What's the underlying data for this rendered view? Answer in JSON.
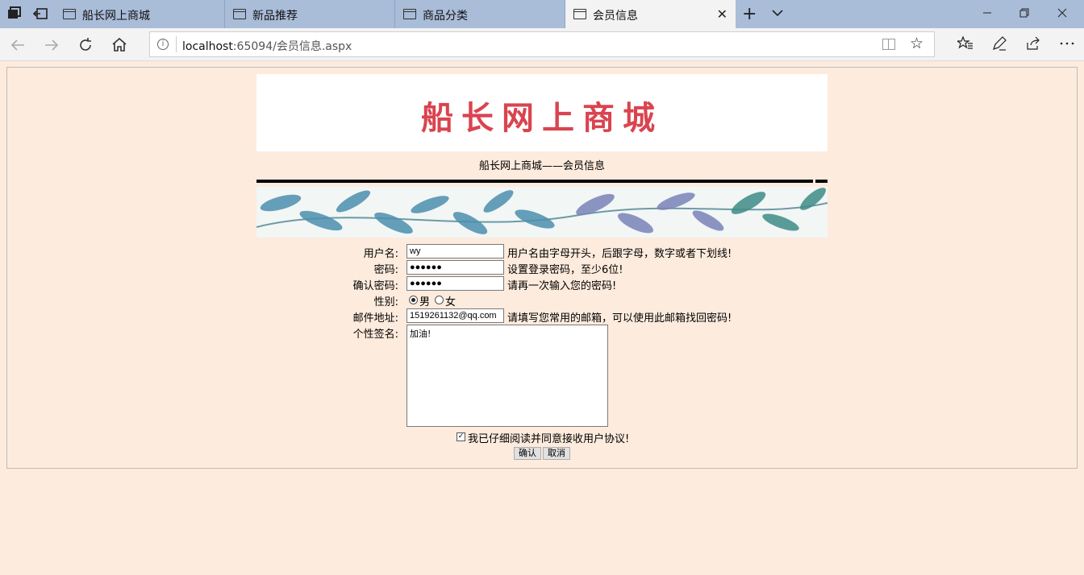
{
  "browser": {
    "tabs": [
      {
        "label": "船长网上商城",
        "active": false
      },
      {
        "label": "新品推荐",
        "active": false
      },
      {
        "label": "商品分类",
        "active": false
      },
      {
        "label": "会员信息",
        "active": true
      }
    ],
    "url_host": "localhost",
    "url_rest": ":65094/会员信息.aspx",
    "new_tab_glyph": "+",
    "close_glyph": "✕"
  },
  "header": {
    "logo_text": "船长网上商城",
    "subtitle": "船长网上商城——会员信息"
  },
  "form": {
    "username": {
      "label": "用户名:",
      "value": "wy",
      "hint": "用户名由字母开头，后跟字母，数字或者下划线!"
    },
    "password": {
      "label": "密码:",
      "value": "●●●●●●",
      "hint": "设置登录密码，至少6位!"
    },
    "confirm": {
      "label": "确认密码:",
      "value": "●●●●●●",
      "hint": "请再一次输入您的密码!"
    },
    "gender": {
      "label": "性别:",
      "options": [
        "男",
        "女"
      ],
      "selected": "男"
    },
    "email": {
      "label": "邮件地址:",
      "value": "1519261132@qq.com",
      "hint": "请填写您常用的邮箱，可以使用此邮箱找回密码!"
    },
    "signature": {
      "label": "个性签名:",
      "value": "加油!"
    },
    "agreement": {
      "label": "我已仔细阅读并同意接收用户协议!",
      "checked": true
    },
    "submit_label": "确认",
    "cancel_label": "取消"
  },
  "colors": {
    "page_bg": "#fdebdd",
    "logo": "#d9444f",
    "tabbar": "#a9bcd8"
  }
}
